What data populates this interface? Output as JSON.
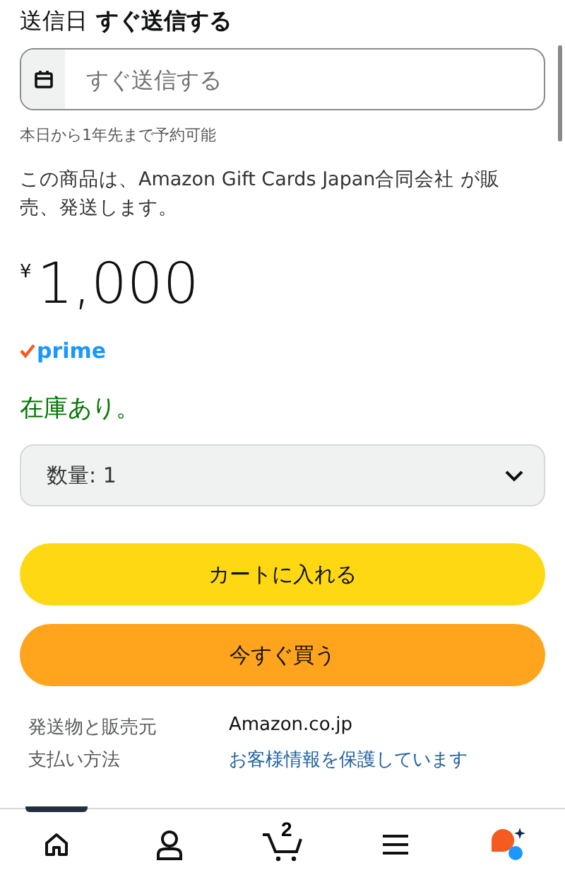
{
  "delivery": {
    "label": "送信日",
    "value": "すぐ送信する"
  },
  "date_field": {
    "placeholder": "すぐ送信する"
  },
  "hint": "本日から1年先まで予約可能",
  "seller_note": "この商品は、Amazon Gift Cards Japan合同会社 が販売、発送します。",
  "price": {
    "currency": "¥",
    "amount": "1,000"
  },
  "prime": "prime",
  "stock": "在庫あり。",
  "quantity": {
    "value": "数量: 1"
  },
  "buttons": [
    {
      "kind": "cart",
      "label": "カートに入れる"
    },
    {
      "kind": "buy",
      "label": "今すぐ買う"
    }
  ],
  "info": [
    {
      "label": "発送物と販売元",
      "value": "Amazon.co.jp",
      "kind": "plain"
    },
    {
      "label": "支払い方法",
      "value": "お客様情報を保護しています",
      "kind": "link"
    }
  ],
  "nav": [
    {
      "kind": "home",
      "selected": true
    },
    {
      "kind": "account",
      "selected": false
    },
    {
      "kind": "cart",
      "selected": false,
      "count": "2"
    },
    {
      "kind": "menu",
      "selected": false
    },
    {
      "kind": "assistant",
      "selected": false
    }
  ]
}
